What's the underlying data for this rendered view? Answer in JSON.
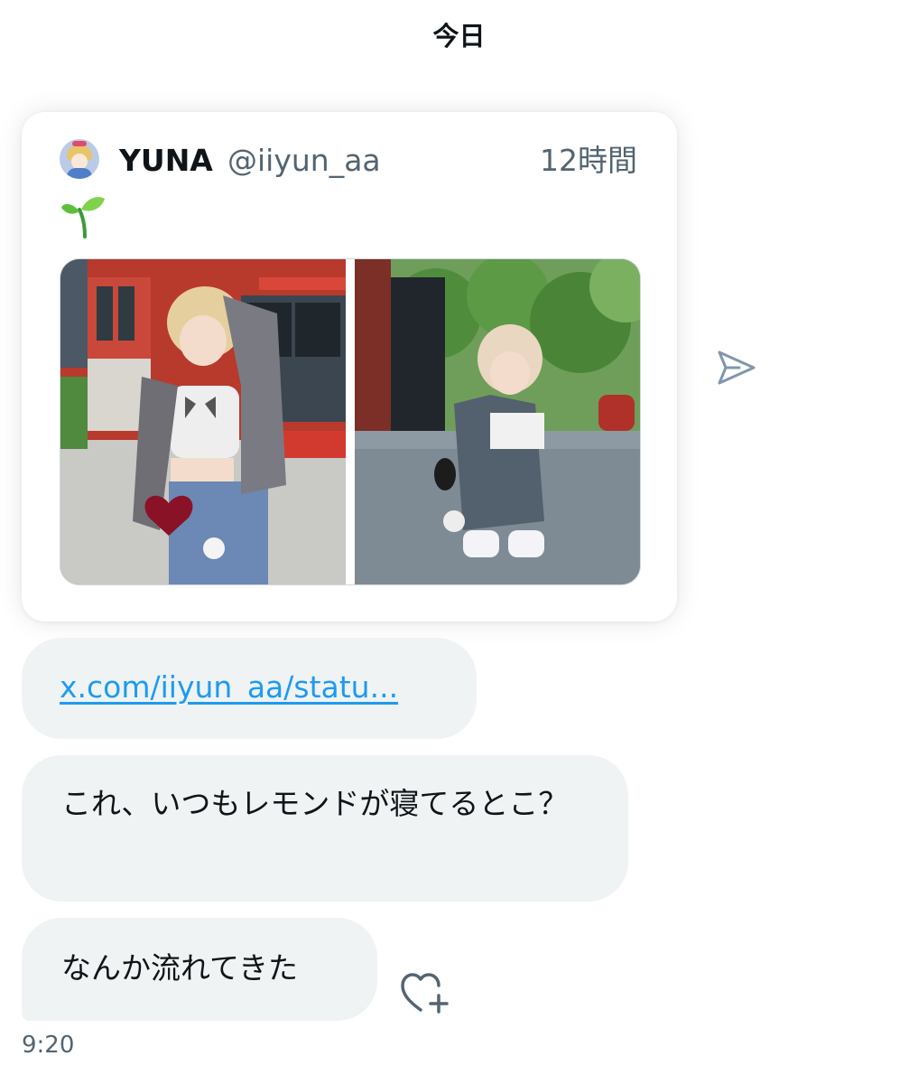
{
  "date_header": "今日",
  "tweet_card": {
    "author_name": "YUNA",
    "author_handle": "@iiyun_aa",
    "time_ago": "12時間",
    "body_emoji_icon": "seedling-icon",
    "photos": [
      {
        "icon": "photo-icon"
      },
      {
        "icon": "photo-icon"
      }
    ]
  },
  "messages": [
    {
      "type": "link",
      "text": "x.com/iiyun_aa/statu..."
    },
    {
      "type": "text",
      "text": "これ、いつもレモンドが寝てるとこ？"
    },
    {
      "type": "text",
      "text": "なんか流れてきた"
    }
  ],
  "timestamp": "9:20",
  "icons": {
    "send": "send-icon",
    "react": "heart-add-icon"
  },
  "colors": {
    "link": "#1d9bf0",
    "bubble_bg": "#eff3f4",
    "secondary_text": "#536471",
    "primary_text": "#0f1419"
  }
}
